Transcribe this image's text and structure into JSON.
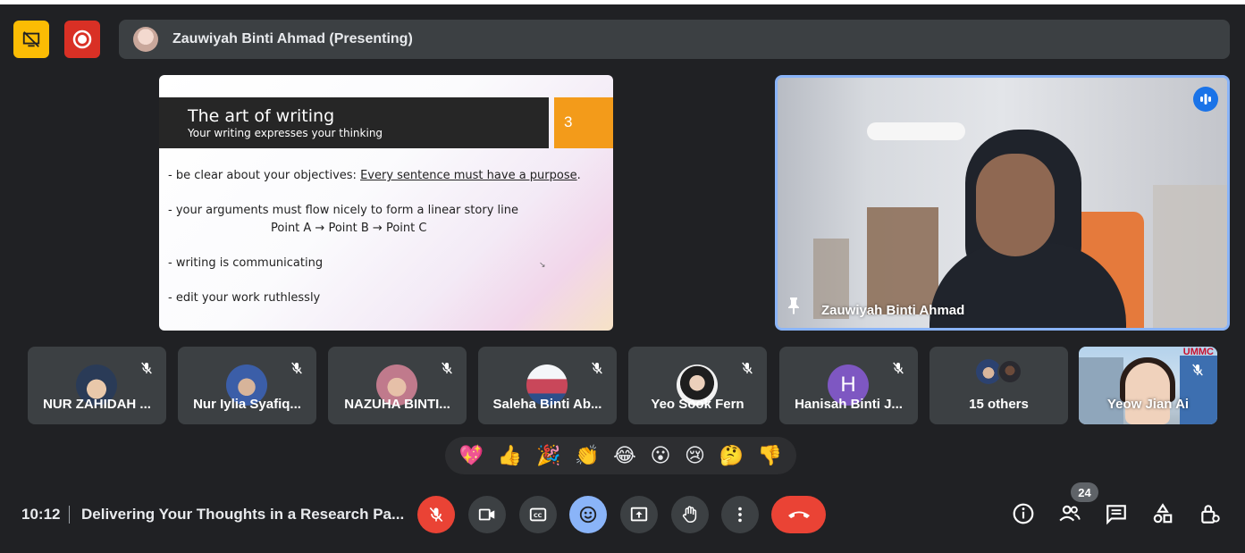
{
  "presenting_bar": {
    "label": "Zauwiyah Binti Ahmad (Presenting)"
  },
  "slide": {
    "title": "The art of writing",
    "subtitle": "Your writing expresses your thinking",
    "number": "3",
    "bullet1_prefix": "- be clear about your objectives: ",
    "bullet1_underlined": "Every sentence must have a purpose",
    "bullet1_suffix": ".",
    "bullet2": "- your arguments must flow nicely to form a linear story line",
    "bullet2_points": "Point A → Point B → Point C",
    "bullet3": "- writing is communicating",
    "bullet4": "- edit your work ruthlessly"
  },
  "speaker_video": {
    "name": "Zauwiyah Binti Ahmad"
  },
  "participants": [
    {
      "name": "NUR ZAHIDAH ..."
    },
    {
      "name": "Nur Iylia Syafiq..."
    },
    {
      "name": "NAZUHA BINTI..."
    },
    {
      "name": "Saleha Binti Ab..."
    },
    {
      "name": "Yeo Sook Fern"
    },
    {
      "name": "Hanisah Binti J...",
      "initial": "H"
    },
    {
      "name": "15 others"
    },
    {
      "name": "Yeow Jian Ai",
      "badge": "UMMC"
    }
  ],
  "reactions": [
    "💖",
    "👍",
    "🎉",
    "👏",
    "😂",
    "😮",
    "😢",
    "🤔",
    "👎"
  ],
  "bottom_bar": {
    "time": "10:12",
    "meeting_title": "Delivering Your Thoughts in a Research Pa...",
    "participant_count": "24"
  },
  "colors": {
    "background": "#202124",
    "surface": "#3c4043",
    "accent_blue": "#8ab4f8",
    "danger_red": "#ea4335",
    "record_yellow": "#fbbc04"
  },
  "icons": {
    "top_left": [
      "presentation-off-icon",
      "record-icon"
    ],
    "controls": [
      "mic-off-icon",
      "camera-icon",
      "captions-icon",
      "emoji-icon",
      "present-screen-icon",
      "raise-hand-icon",
      "more-options-icon",
      "end-call-icon"
    ],
    "right_tools": [
      "info-icon",
      "people-icon",
      "chat-icon",
      "activities-icon",
      "host-controls-icon"
    ]
  }
}
